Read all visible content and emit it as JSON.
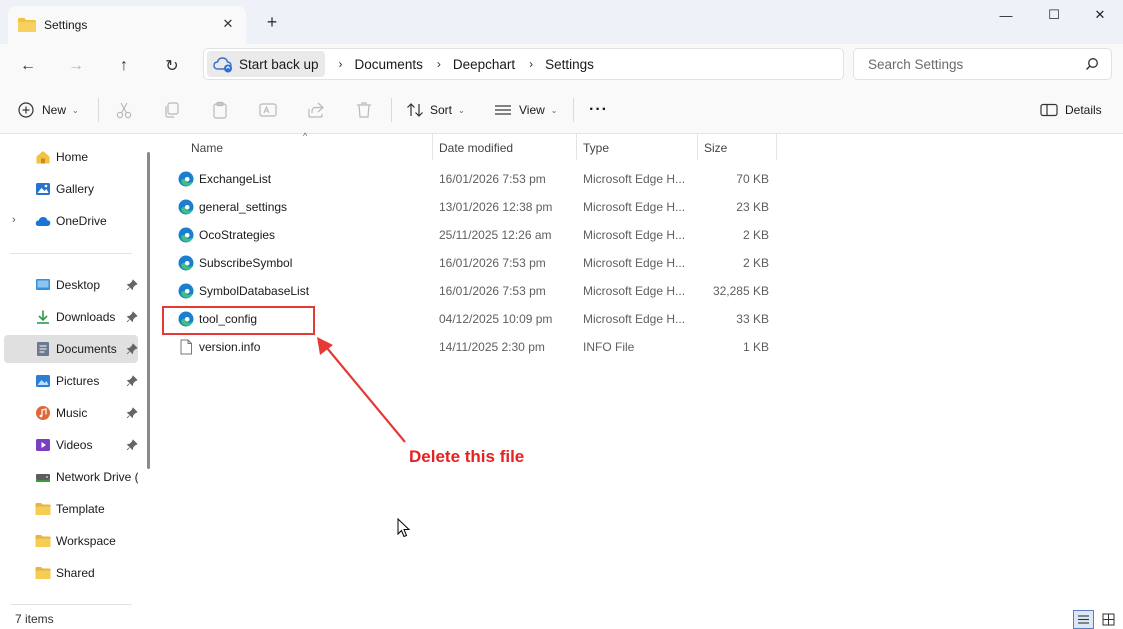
{
  "window": {
    "tab_title": "Settings",
    "tab_close": "✕",
    "new_tab": "+",
    "minimize": "—",
    "maximize": "☐",
    "close": "✕"
  },
  "nav": {
    "back": "←",
    "forward": "→",
    "up": "↑",
    "refresh": "↻"
  },
  "address": {
    "home_label": "Start back up",
    "separator": "›",
    "crumbs": [
      "Documents",
      "Deepchart",
      "Settings"
    ]
  },
  "search": {
    "placeholder": "Search Settings"
  },
  "toolbar": {
    "new_label": "New",
    "sort_label": "Sort",
    "view_label": "View",
    "more_label": "···",
    "details_label": "Details",
    "caret": "⌄"
  },
  "sidebar": {
    "expand_chevron": "›",
    "items": [
      {
        "label": "Home",
        "icon": "home-icon"
      },
      {
        "label": "Gallery",
        "icon": "gallery-icon"
      },
      {
        "label": "OneDrive",
        "icon": "onedrive-icon"
      },
      {
        "label": "Desktop",
        "icon": "desktop-icon"
      },
      {
        "label": "Downloads",
        "icon": "downloads-icon"
      },
      {
        "label": "Documents",
        "icon": "documents-icon"
      },
      {
        "label": "Pictures",
        "icon": "pictures-icon"
      },
      {
        "label": "Music",
        "icon": "music-icon"
      },
      {
        "label": "Videos",
        "icon": "videos-icon"
      },
      {
        "label": "Network Drive (Z",
        "icon": "network-drive-icon"
      },
      {
        "label": "Template",
        "icon": "folder-icon"
      },
      {
        "label": "Workspace",
        "icon": "folder-icon"
      },
      {
        "label": "Shared",
        "icon": "folder-icon"
      }
    ]
  },
  "columns": {
    "name": "Name",
    "date": "Date modified",
    "type": "Type",
    "size": "Size",
    "sort_indicator": "^"
  },
  "files": [
    {
      "name": "ExchangeList",
      "date": "16/01/2026 7:53 pm",
      "type": "Microsoft Edge H...",
      "size": "70 KB",
      "icon": "edge-icon"
    },
    {
      "name": "general_settings",
      "date": "13/01/2026 12:38 pm",
      "type": "Microsoft Edge H...",
      "size": "23 KB",
      "icon": "edge-icon"
    },
    {
      "name": "OcoStrategies",
      "date": "25/11/2025 12:26 am",
      "type": "Microsoft Edge H...",
      "size": "2 KB",
      "icon": "edge-icon"
    },
    {
      "name": "SubscribeSymbol",
      "date": "16/01/2026 7:53 pm",
      "type": "Microsoft Edge H...",
      "size": "2 KB",
      "icon": "edge-icon"
    },
    {
      "name": "SymbolDatabaseList",
      "date": "16/01/2026 7:53 pm",
      "type": "Microsoft Edge H...",
      "size": "32,285 KB",
      "icon": "edge-icon"
    },
    {
      "name": "tool_config",
      "date": "04/12/2025 10:09 pm",
      "type": "Microsoft Edge H...",
      "size": "33 KB",
      "icon": "edge-icon"
    },
    {
      "name": "version.info",
      "date": "14/11/2025 2:30 pm",
      "type": "INFO File",
      "size": "1 KB",
      "icon": "file-icon"
    }
  ],
  "annotation": {
    "text": "Delete this file",
    "color": "#e52222"
  },
  "status": {
    "item_count": "7 items"
  },
  "colors": {
    "titlebar": "#eef2f8",
    "toolbar": "#f9f9f9",
    "edge_blue": "#1b7fd1",
    "edge_green": "#3cc27a",
    "folder_yellow": "#f3c242",
    "annotation_red": "#e53935"
  }
}
